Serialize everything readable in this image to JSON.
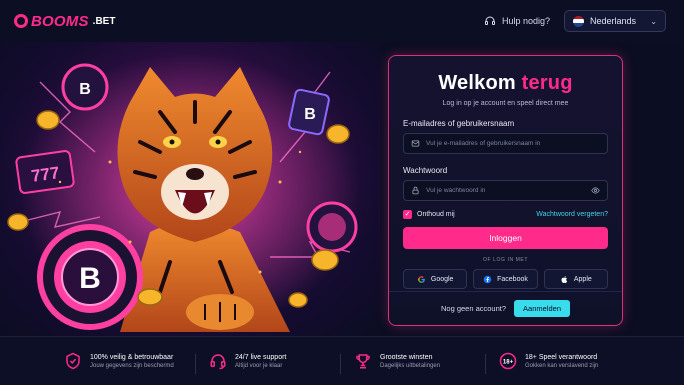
{
  "brand": {
    "logo_main": "BOOMS",
    "logo_suffix": ".BET"
  },
  "header": {
    "help_label": "Hulp nodig?",
    "language": "Nederlands"
  },
  "login": {
    "title_main": "Welkom",
    "title_accent": "terug",
    "subtitle": "Log in op je account en speel direct mee",
    "email_label": "E-mailadres of gebruikersnaam",
    "email_placeholder": "Vul je e-mailadres of gebruikersnaam in",
    "password_label": "Wachtwoord",
    "password_placeholder": "Vul je wachtwoord in",
    "remember_label": "Onthoud mij",
    "remember_checked": true,
    "forgot_label": "Wachtwoord vergeten?",
    "login_button": "Inloggen",
    "divider": "OF LOG IN MET",
    "socials": [
      "Google",
      "Facebook",
      "Apple"
    ],
    "no_account": "Nog geen account?",
    "signup_button": "Aanmelden"
  },
  "features": [
    {
      "title": "100% veilig & betrouwbaar",
      "sub": "Jouw gegevens zijn beschermd",
      "icon": "shield-check-icon"
    },
    {
      "title": "24/7 live support",
      "sub": "Altijd voor je klaar",
      "icon": "headset-icon"
    },
    {
      "title": "Grootste winsten",
      "sub": "Dagelijks uitbetalingen",
      "icon": "trophy-icon"
    },
    {
      "title": "18+ Speel verantwoord",
      "sub": "Gokken kan verslavend zijn",
      "icon": "age-18-icon"
    }
  ],
  "hero": {
    "chip_letter": "B",
    "slot_text": "777"
  },
  "colors": {
    "accent": "#ff2a8a",
    "cyan": "#38dced",
    "background": "#0b0d22"
  }
}
